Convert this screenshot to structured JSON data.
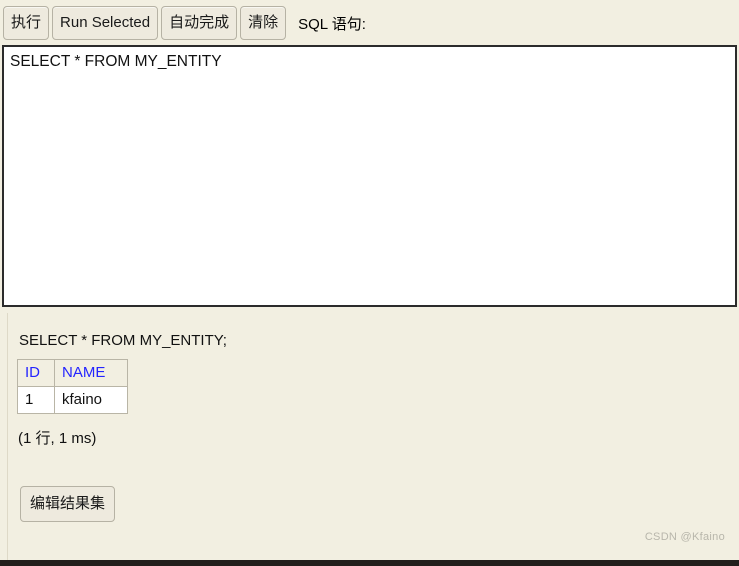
{
  "toolbar": {
    "buttons": [
      {
        "label": "执行",
        "name": "run-button"
      },
      {
        "label": "Run Selected",
        "name": "run-selected-button"
      },
      {
        "label": "自动完成",
        "name": "auto-complete-button"
      },
      {
        "label": "清除",
        "name": "clear-button"
      }
    ],
    "sql_label": "SQL 语句:"
  },
  "editor": {
    "value": "SELECT * FROM MY_ENTITY",
    "placeholder": ""
  },
  "results": {
    "query_echo": "SELECT * FROM MY_ENTITY;",
    "columns": [
      "ID",
      "NAME"
    ],
    "rows": [
      {
        "id": "1",
        "name": "kfaino"
      }
    ],
    "status": "(1 行, 1 ms)",
    "edit_button_label": "编辑结果集"
  },
  "watermark": "CSDN @Kfaino",
  "colors": {
    "panel_bg": "#f2efe1",
    "button_bg": "#eeeade",
    "button_border": "#b6b2a4",
    "editor_bg": "#ffffff",
    "editor_border": "#2b2b2b",
    "header_text": "#2424ff",
    "watermark_text": "#b8b6ab",
    "bottom_bar": "#221f1c"
  }
}
